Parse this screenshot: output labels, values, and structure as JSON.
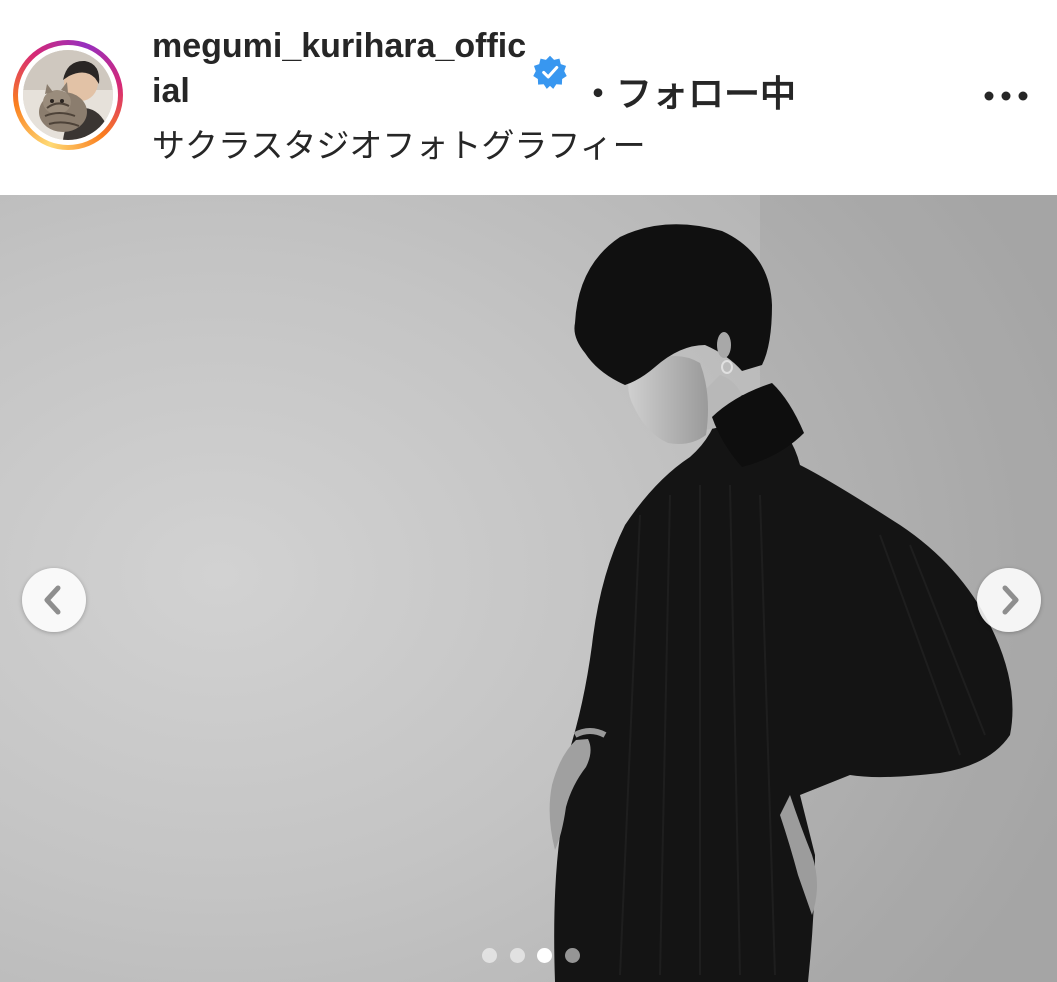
{
  "header": {
    "username": "megumi_kurihara_official",
    "follow_status": "・フォロー中",
    "subtitle": "サクラスタジオフォトグラフィー"
  },
  "icons": {
    "verified": "verified-badge-icon",
    "more": "more-options-icon",
    "prev": "chevron-left-icon",
    "next": "chevron-right-icon"
  },
  "carousel": {
    "total": 4,
    "active_index": 3
  },
  "colors": {
    "verified_blue": "#3897f0",
    "text": "#262626"
  }
}
